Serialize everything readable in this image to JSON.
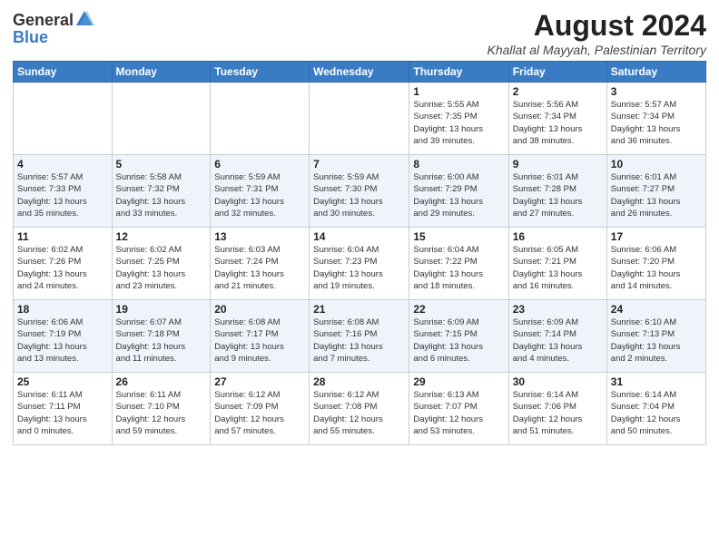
{
  "logo": {
    "general": "General",
    "blue": "Blue"
  },
  "header": {
    "month_year": "August 2024",
    "location": "Khallat al Mayyah, Palestinian Territory"
  },
  "weekdays": [
    "Sunday",
    "Monday",
    "Tuesday",
    "Wednesday",
    "Thursday",
    "Friday",
    "Saturday"
  ],
  "weeks": [
    [
      {
        "day": "",
        "info": ""
      },
      {
        "day": "",
        "info": ""
      },
      {
        "day": "",
        "info": ""
      },
      {
        "day": "",
        "info": ""
      },
      {
        "day": "1",
        "info": "Sunrise: 5:55 AM\nSunset: 7:35 PM\nDaylight: 13 hours\nand 39 minutes."
      },
      {
        "day": "2",
        "info": "Sunrise: 5:56 AM\nSunset: 7:34 PM\nDaylight: 13 hours\nand 38 minutes."
      },
      {
        "day": "3",
        "info": "Sunrise: 5:57 AM\nSunset: 7:34 PM\nDaylight: 13 hours\nand 36 minutes."
      }
    ],
    [
      {
        "day": "4",
        "info": "Sunrise: 5:57 AM\nSunset: 7:33 PM\nDaylight: 13 hours\nand 35 minutes."
      },
      {
        "day": "5",
        "info": "Sunrise: 5:58 AM\nSunset: 7:32 PM\nDaylight: 13 hours\nand 33 minutes."
      },
      {
        "day": "6",
        "info": "Sunrise: 5:59 AM\nSunset: 7:31 PM\nDaylight: 13 hours\nand 32 minutes."
      },
      {
        "day": "7",
        "info": "Sunrise: 5:59 AM\nSunset: 7:30 PM\nDaylight: 13 hours\nand 30 minutes."
      },
      {
        "day": "8",
        "info": "Sunrise: 6:00 AM\nSunset: 7:29 PM\nDaylight: 13 hours\nand 29 minutes."
      },
      {
        "day": "9",
        "info": "Sunrise: 6:01 AM\nSunset: 7:28 PM\nDaylight: 13 hours\nand 27 minutes."
      },
      {
        "day": "10",
        "info": "Sunrise: 6:01 AM\nSunset: 7:27 PM\nDaylight: 13 hours\nand 26 minutes."
      }
    ],
    [
      {
        "day": "11",
        "info": "Sunrise: 6:02 AM\nSunset: 7:26 PM\nDaylight: 13 hours\nand 24 minutes."
      },
      {
        "day": "12",
        "info": "Sunrise: 6:02 AM\nSunset: 7:25 PM\nDaylight: 13 hours\nand 23 minutes."
      },
      {
        "day": "13",
        "info": "Sunrise: 6:03 AM\nSunset: 7:24 PM\nDaylight: 13 hours\nand 21 minutes."
      },
      {
        "day": "14",
        "info": "Sunrise: 6:04 AM\nSunset: 7:23 PM\nDaylight: 13 hours\nand 19 minutes."
      },
      {
        "day": "15",
        "info": "Sunrise: 6:04 AM\nSunset: 7:22 PM\nDaylight: 13 hours\nand 18 minutes."
      },
      {
        "day": "16",
        "info": "Sunrise: 6:05 AM\nSunset: 7:21 PM\nDaylight: 13 hours\nand 16 minutes."
      },
      {
        "day": "17",
        "info": "Sunrise: 6:06 AM\nSunset: 7:20 PM\nDaylight: 13 hours\nand 14 minutes."
      }
    ],
    [
      {
        "day": "18",
        "info": "Sunrise: 6:06 AM\nSunset: 7:19 PM\nDaylight: 13 hours\nand 13 minutes."
      },
      {
        "day": "19",
        "info": "Sunrise: 6:07 AM\nSunset: 7:18 PM\nDaylight: 13 hours\nand 11 minutes."
      },
      {
        "day": "20",
        "info": "Sunrise: 6:08 AM\nSunset: 7:17 PM\nDaylight: 13 hours\nand 9 minutes."
      },
      {
        "day": "21",
        "info": "Sunrise: 6:08 AM\nSunset: 7:16 PM\nDaylight: 13 hours\nand 7 minutes."
      },
      {
        "day": "22",
        "info": "Sunrise: 6:09 AM\nSunset: 7:15 PM\nDaylight: 13 hours\nand 6 minutes."
      },
      {
        "day": "23",
        "info": "Sunrise: 6:09 AM\nSunset: 7:14 PM\nDaylight: 13 hours\nand 4 minutes."
      },
      {
        "day": "24",
        "info": "Sunrise: 6:10 AM\nSunset: 7:13 PM\nDaylight: 13 hours\nand 2 minutes."
      }
    ],
    [
      {
        "day": "25",
        "info": "Sunrise: 6:11 AM\nSunset: 7:11 PM\nDaylight: 13 hours\nand 0 minutes."
      },
      {
        "day": "26",
        "info": "Sunrise: 6:11 AM\nSunset: 7:10 PM\nDaylight: 12 hours\nand 59 minutes."
      },
      {
        "day": "27",
        "info": "Sunrise: 6:12 AM\nSunset: 7:09 PM\nDaylight: 12 hours\nand 57 minutes."
      },
      {
        "day": "28",
        "info": "Sunrise: 6:12 AM\nSunset: 7:08 PM\nDaylight: 12 hours\nand 55 minutes."
      },
      {
        "day": "29",
        "info": "Sunrise: 6:13 AM\nSunset: 7:07 PM\nDaylight: 12 hours\nand 53 minutes."
      },
      {
        "day": "30",
        "info": "Sunrise: 6:14 AM\nSunset: 7:06 PM\nDaylight: 12 hours\nand 51 minutes."
      },
      {
        "day": "31",
        "info": "Sunrise: 6:14 AM\nSunset: 7:04 PM\nDaylight: 12 hours\nand 50 minutes."
      }
    ]
  ]
}
